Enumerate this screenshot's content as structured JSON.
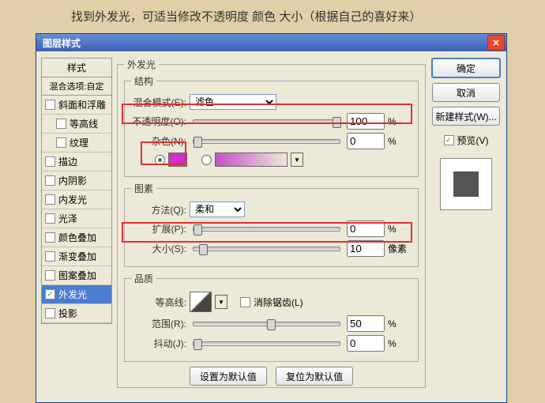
{
  "instruction_text": "　　找到外发光，可适当修改不透明度 颜色 大小（根据自己的喜好来）",
  "dialog": {
    "title": "图层样式"
  },
  "left": {
    "header": "样式",
    "blend": "混合选项:自定",
    "items": [
      {
        "label": "斜面和浮雕",
        "checked": false,
        "sub": false,
        "sel": false
      },
      {
        "label": "等高线",
        "checked": false,
        "sub": true,
        "sel": false
      },
      {
        "label": "纹理",
        "checked": false,
        "sub": true,
        "sel": false
      },
      {
        "label": "描边",
        "checked": false,
        "sub": false,
        "sel": false
      },
      {
        "label": "内阴影",
        "checked": false,
        "sub": false,
        "sel": false
      },
      {
        "label": "内发光",
        "checked": false,
        "sub": false,
        "sel": false
      },
      {
        "label": "光泽",
        "checked": false,
        "sub": false,
        "sel": false
      },
      {
        "label": "颜色叠加",
        "checked": false,
        "sub": false,
        "sel": false
      },
      {
        "label": "渐变叠加",
        "checked": false,
        "sub": false,
        "sel": false
      },
      {
        "label": "图案叠加",
        "checked": false,
        "sub": false,
        "sel": false
      },
      {
        "label": "外发光",
        "checked": true,
        "sub": false,
        "sel": true
      },
      {
        "label": "投影",
        "checked": false,
        "sub": false,
        "sel": false
      }
    ]
  },
  "panel": {
    "title": "外发光",
    "struct": {
      "legend": "结构",
      "blend_label": "混合模式(E):",
      "blend_value": "滤色",
      "opacity_label": "不透明度(O):",
      "opacity_value": "100",
      "opacity_unit": "%",
      "noise_label": "杂色(N):",
      "noise_value": "0",
      "noise_unit": "%",
      "color": "#cc33cc"
    },
    "elem": {
      "legend": "图素",
      "method_label": "方法(Q):",
      "method_value": "柔和",
      "spread_label": "扩展(P):",
      "spread_value": "0",
      "spread_unit": "%",
      "size_label": "大小(S):",
      "size_value": "10",
      "size_unit": "像素"
    },
    "qual": {
      "legend": "品质",
      "contour_label": "等高线:",
      "aa_label": "消除锯齿(L)",
      "range_label": "范围(R):",
      "range_value": "50",
      "range_unit": "%",
      "jitter_label": "抖动(J):",
      "jitter_value": "0",
      "jitter_unit": "%"
    },
    "btn_default": "设置为默认值",
    "btn_reset": "复位为默认值"
  },
  "right": {
    "ok": "确定",
    "cancel": "取消",
    "newstyle": "新建样式(W)...",
    "preview": "预览(V)"
  }
}
